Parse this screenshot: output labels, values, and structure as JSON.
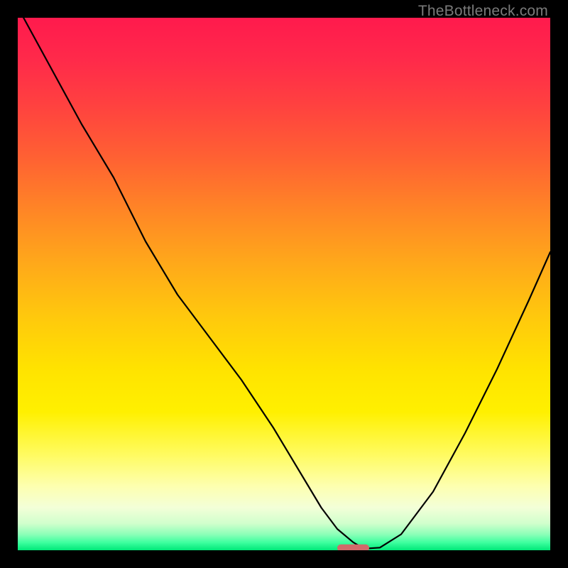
{
  "watermark": "TheBottleneck.com",
  "chart_data": {
    "type": "line",
    "title": "",
    "xlabel": "",
    "ylabel": "",
    "xlim": [
      0,
      100
    ],
    "ylim": [
      0,
      100
    ],
    "grid": false,
    "series": [
      {
        "name": "curve",
        "x": [
          0,
          6,
          12,
          18,
          24,
          30,
          36,
          42,
          48,
          54,
          57,
          60,
          63,
          65,
          68,
          72,
          78,
          84,
          90,
          96,
          100
        ],
        "y": [
          102,
          91,
          80,
          70,
          58,
          48,
          40,
          32,
          23,
          13,
          8,
          4,
          1.5,
          0.3,
          0.5,
          3,
          11,
          22,
          34,
          47,
          56
        ]
      }
    ],
    "marker": {
      "x": 63,
      "y": 0.3,
      "width": 6,
      "color": "#d16a6a"
    },
    "background_gradient": {
      "top": "#ff1a4d",
      "bottom": "#00e878"
    }
  }
}
